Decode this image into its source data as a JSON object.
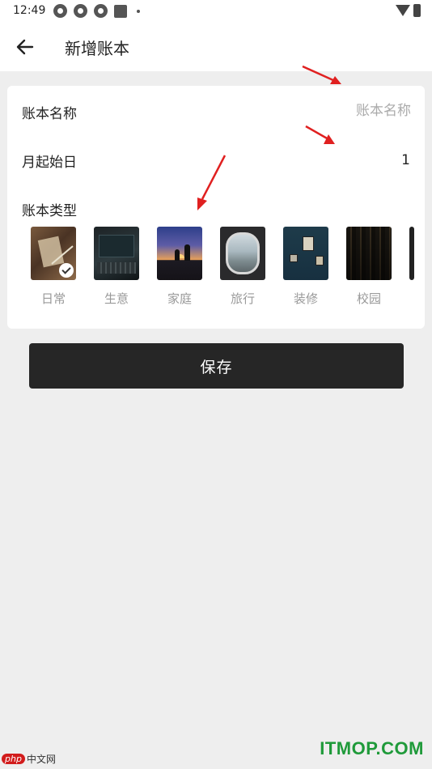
{
  "status_bar": {
    "time": "12:49"
  },
  "app_bar": {
    "title": "新增账本",
    "back_icon": "arrow-left-icon"
  },
  "form": {
    "name_label": "账本名称",
    "name_placeholder": "账本名称",
    "start_day_label": "月起始日",
    "start_day_value": "1",
    "type_label": "账本类型",
    "types": [
      {
        "label": "日常",
        "selected": true
      },
      {
        "label": "生意",
        "selected": false
      },
      {
        "label": "家庭",
        "selected": false
      },
      {
        "label": "旅行",
        "selected": false
      },
      {
        "label": "装修",
        "selected": false
      },
      {
        "label": "校园",
        "selected": false
      }
    ]
  },
  "save_button": {
    "label": "保存"
  },
  "annotations": {
    "arrow_color": "#e02020"
  },
  "watermarks": {
    "left_badge": "php",
    "left_text": "中文网",
    "right_text": "ITMOP.COM"
  }
}
